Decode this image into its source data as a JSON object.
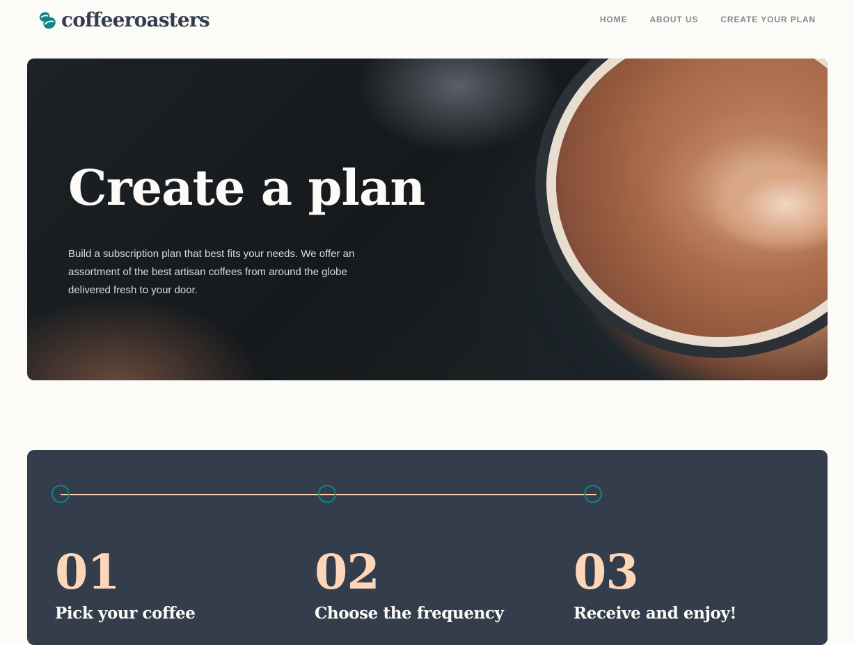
{
  "brand": {
    "name": "coffeeroasters",
    "accent_color": "#0e8784",
    "dark_color": "#333d4b",
    "peach_color": "#fdd6ba"
  },
  "nav": {
    "items": [
      {
        "label": "HOME"
      },
      {
        "label": "ABOUT US"
      },
      {
        "label": "CREATE YOUR PLAN"
      }
    ]
  },
  "hero": {
    "title": "Create a plan",
    "text": "Build a subscription plan that best fits your needs. We offer an assortment of the best artisan coffees from around the globe delivered fresh to your door."
  },
  "steps": [
    {
      "number": "01",
      "title": "Pick your coffee"
    },
    {
      "number": "02",
      "title": "Choose the frequency"
    },
    {
      "number": "03",
      "title": "Receive and enjoy!"
    }
  ]
}
